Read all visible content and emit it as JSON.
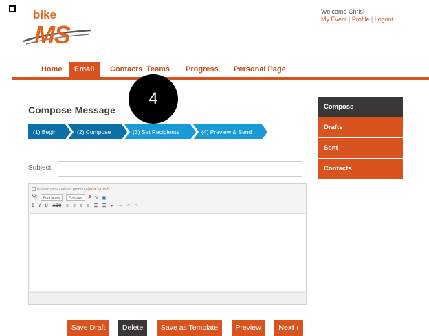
{
  "logo": {
    "top": "bike",
    "main": "MS",
    "reg": "."
  },
  "header": {
    "welcome": "Welcome Chris!",
    "links": [
      "My Event",
      "Profile",
      "Logout"
    ],
    "separator": " | "
  },
  "nav": {
    "items": [
      "Home",
      "Email",
      "Contacts",
      "Teams",
      "Progress",
      "Personal Page"
    ],
    "active": "Email"
  },
  "overlay": {
    "step_number": "4"
  },
  "main": {
    "title": "Compose Message",
    "steps": [
      {
        "num": "1",
        "label": "Begin"
      },
      {
        "num": "2",
        "label": "Compose"
      },
      {
        "num": "3",
        "label": "Set Recipients"
      },
      {
        "num": "4",
        "label": "Preview & Send"
      }
    ],
    "subject_label": "Subject:",
    "subject_value": "",
    "editor": {
      "greeting_label": "Include personalized greeting",
      "greeting_link": "(what's this?)",
      "font_family": "Font family",
      "font_size": "Font size",
      "format_buttons": [
        "B",
        "I",
        "U",
        "ABC"
      ]
    }
  },
  "sidebar": {
    "items": [
      "Compose",
      "Drafts",
      "Sent",
      "Contacts"
    ],
    "active": "Compose"
  },
  "buttons": {
    "save_draft": "Save Draft",
    "delete": "Delete",
    "save_template": "Save as Template",
    "preview": "Preview",
    "next": "Next ›"
  },
  "colors": {
    "accent": "#d9531e",
    "dark": "#3a3836",
    "step_blue": "#1a9ad6",
    "step_dark": "#0b6fa8"
  }
}
